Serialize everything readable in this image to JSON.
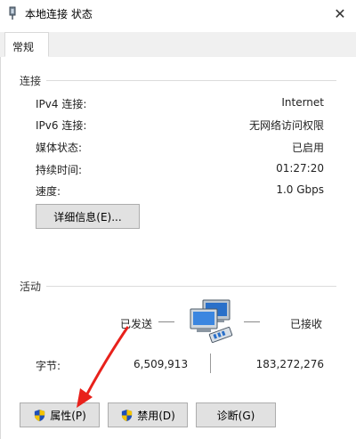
{
  "window": {
    "title": "本地连接 状态",
    "close_glyph": "✕"
  },
  "tabs": [
    {
      "label": "常规",
      "selected": true
    }
  ],
  "connection": {
    "group_label": "连接",
    "rows": [
      {
        "label": "IPv4 连接:",
        "value": "Internet"
      },
      {
        "label": "IPv6 连接:",
        "value": "无网络访问权限"
      },
      {
        "label": "媒体状态:",
        "value": "已启用"
      },
      {
        "label": "持续时间:",
        "value": "01:27:20"
      },
      {
        "label": "速度:",
        "value": "1.0 Gbps"
      }
    ],
    "details_button": "详细信息(E)..."
  },
  "activity": {
    "group_label": "活动",
    "sent_label": "已发送",
    "received_label": "已接收",
    "bytes_label": "字节:",
    "bytes_sent": "6,509,913",
    "bytes_received": "183,272,276",
    "icon": "network-computers-icon"
  },
  "buttons": {
    "properties": "属性(P)",
    "disable": "禁用(D)",
    "diagnose": "诊断(G)"
  },
  "annotation": {
    "color": "#e8211b",
    "icon": "red-arrow"
  },
  "colors": {
    "button_bg": "#e1e1e1",
    "button_border": "#adadad",
    "accent": "#0078d7"
  }
}
